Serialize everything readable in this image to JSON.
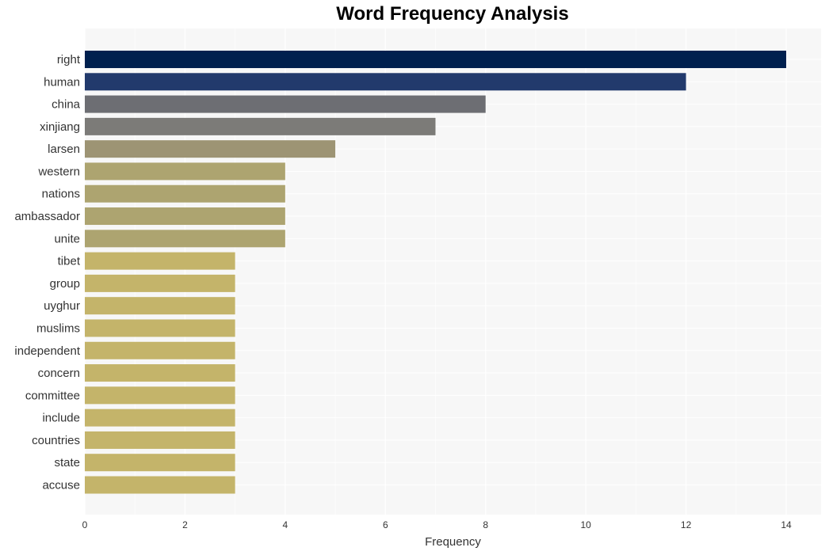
{
  "chart_data": {
    "type": "bar",
    "orientation": "horizontal",
    "title": "Word Frequency Analysis",
    "xlabel": "Frequency",
    "ylabel": "",
    "xlim": [
      0,
      14.7
    ],
    "xticks": [
      0,
      2,
      4,
      6,
      8,
      10,
      12,
      14
    ],
    "grid": true,
    "background": "#f7f7f7",
    "categories": [
      "right",
      "human",
      "china",
      "xinjiang",
      "larsen",
      "western",
      "nations",
      "ambassador",
      "unite",
      "tibet",
      "group",
      "uyghur",
      "muslims",
      "independent",
      "concern",
      "committee",
      "include",
      "countries",
      "state",
      "accuse"
    ],
    "values": [
      14,
      12,
      8,
      7,
      5,
      4,
      4,
      4,
      4,
      3,
      3,
      3,
      3,
      3,
      3,
      3,
      3,
      3,
      3,
      3
    ],
    "colors": [
      "#00204e",
      "#223a6c",
      "#6d6e73",
      "#7c7b78",
      "#9d9474",
      "#ada470",
      "#ada470",
      "#ada470",
      "#ada470",
      "#c4b46a",
      "#c4b46a",
      "#c4b46a",
      "#c4b46a",
      "#c4b46a",
      "#c4b46a",
      "#c4b46a",
      "#c4b46a",
      "#c4b46a",
      "#c4b46a",
      "#c4b46a"
    ]
  }
}
